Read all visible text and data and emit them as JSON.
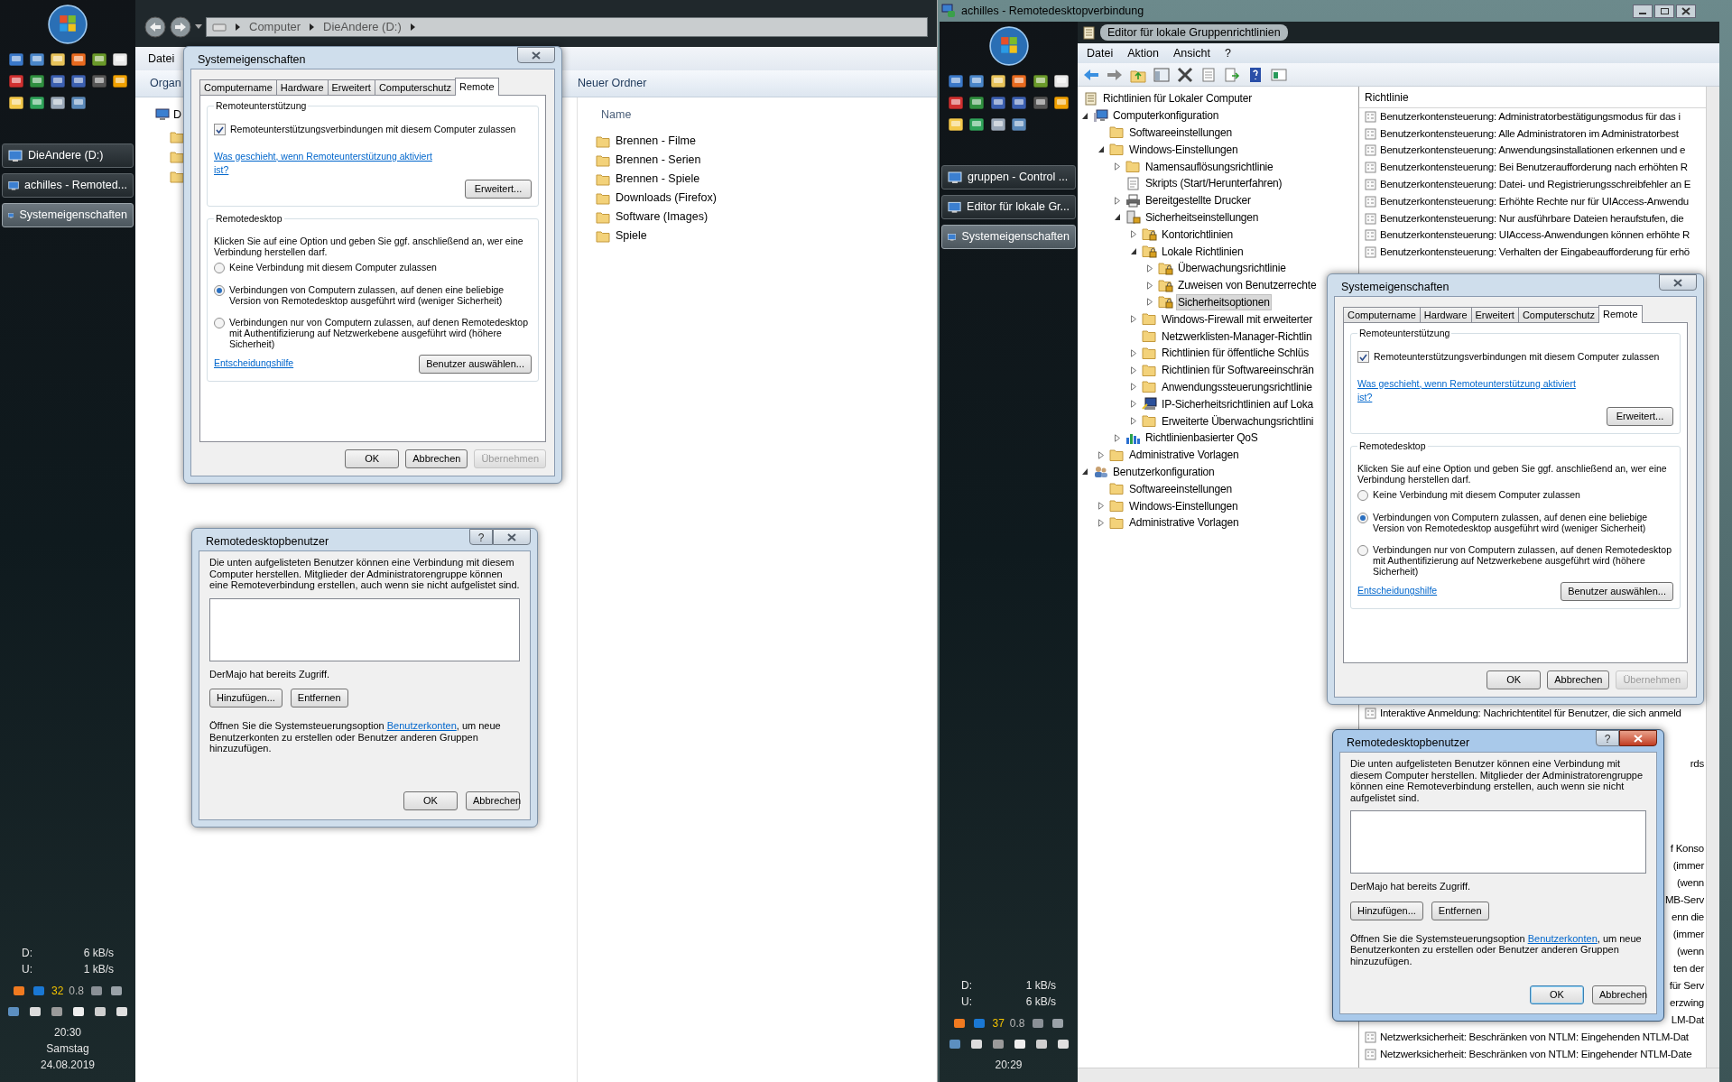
{
  "left_sidebar": {
    "taskbar": [
      {
        "label": "DieAndere (D:)",
        "selected": false
      },
      {
        "label": "achilles - Remoted...",
        "selected": false
      },
      {
        "label": "Systemeigenschaften",
        "selected": true
      }
    ],
    "net": [
      {
        "label": "D:",
        "value": "6 kB/s"
      },
      {
        "label": "U:",
        "value": "1 kB/s"
      }
    ],
    "tray_numbers": [
      {
        "text": "32",
        "color": "#f2c200"
      },
      {
        "text": "0.8",
        "color": "#b8b8b8"
      }
    ],
    "time": "20:30",
    "day": "Samstag",
    "date": "24.08.2019"
  },
  "explorer": {
    "breadcrumb": [
      "Computer",
      "DieAndere (D:)"
    ],
    "menu": [
      "Datei"
    ],
    "toolbar": [
      "Organ",
      "Neuer Ordner"
    ],
    "nav_label": "D",
    "column": "Name",
    "files": [
      "Brennen - Filme",
      "Brennen - Serien",
      "Brennen - Spiele",
      "Downloads (Firefox)",
      "Software (Images)",
      "Spiele"
    ]
  },
  "left_dialogs": {
    "system_properties": {
      "title": "Systemeigenschaften",
      "active": false,
      "tabs": [
        {
          "label": "Computername",
          "selected": false
        },
        {
          "label": "Hardware",
          "selected": false
        },
        {
          "label": "Erweitert",
          "selected": false
        },
        {
          "label": "Computerschutz",
          "selected": false
        },
        {
          "label": "Remote",
          "selected": true
        }
      ],
      "assistance": {
        "heading": "Remoteunterstützung",
        "checkbox": {
          "label": "Remoteunterstützungsverbindungen mit diesem Computer zulassen",
          "checked": true
        },
        "link": "Was geschieht, wenn Remoteunterstützung aktiviert ist?",
        "button": "Erweitert..."
      },
      "desktop": {
        "heading": "Remotedesktop",
        "intro": "Klicken Sie auf eine Option und geben Sie ggf. anschließend an, wer eine Verbindung herstellen darf.",
        "options": [
          {
            "label": "Keine Verbindung mit diesem Computer zulassen",
            "selected": false
          },
          {
            "label": "Verbindungen von Computern zulassen, auf denen eine beliebige Version von Remotedesktop ausgeführt wird (weniger Sicherheit)",
            "selected": true
          },
          {
            "label": "Verbindungen nur von Computern zulassen, auf denen Remotedesktop mit Authentifizierung auf Netzwerkebene ausgeführt wird (höhere Sicherheit)",
            "selected": false
          }
        ],
        "link": "Entscheidungshilfe",
        "button": "Benutzer auswählen..."
      },
      "buttons": [
        {
          "label": "OK",
          "disabled": false
        },
        {
          "label": "Abbrechen",
          "disabled": false
        },
        {
          "label": "Übernehmen",
          "disabled": true
        }
      ]
    },
    "remote_users": {
      "title": "Remotedesktopbenutzer",
      "active": false,
      "help": "?",
      "intro": "Die unten aufgelisteten Benutzer können eine Verbindung mit diesem Computer herstellen. Mitglieder der Administratorengruppe können eine Remoteverbindung erstellen, auch wenn sie nicht aufgelistet sind.",
      "status": "DerMajo hat bereits Zugriff.",
      "actions": [
        "Hinzufügen...",
        "Entfernen"
      ],
      "note_before": "Öffnen Sie die Systemsteuerungsoption ",
      "note_link": "Benutzerkonten",
      "note_after": ", um neue Benutzerkonten zu erstellen oder Benutzer anderen Gruppen hinzuzufügen.",
      "buttons": [
        "OK",
        "Abbrechen"
      ]
    }
  },
  "remote_window": {
    "title": "achilles - Remotedesktopverbindung",
    "sidebar": {
      "taskbar": [
        {
          "label": "gruppen - Control ...",
          "selected": false
        },
        {
          "label": "Editor für lokale Gr...",
          "selected": false
        },
        {
          "label": "Systemeigenschaften",
          "selected": true
        }
      ],
      "net": [
        {
          "label": "D:",
          "value": "1 kB/s"
        },
        {
          "label": "U:",
          "value": "6 kB/s"
        }
      ],
      "tray_numbers": [
        {
          "text": "37",
          "color": "#f2c200"
        },
        {
          "text": "0.8",
          "color": "#b8b8b8"
        }
      ],
      "time": "20:29"
    },
    "editor": {
      "title": "Editor für lokale Gruppenrichtlinien",
      "menu": [
        "Datei",
        "Aktion",
        "Ansicht",
        "?"
      ],
      "tree": [
        {
          "label": "Richtlinien für Lokaler Computer",
          "kind": "policy",
          "selected": false,
          "children": [
            {
              "label": "Computerkonfiguration",
              "kind": "computer",
              "expanded": true,
              "selected": false,
              "children": [
                {
                  "label": "Softwareeinstellungen",
                  "kind": "folder",
                  "selected": false
                },
                {
                  "label": "Windows-Einstellungen",
                  "kind": "folder",
                  "expanded": true,
                  "selected": false,
                  "children": [
                    {
                      "label": "Namensauflösungsrichtlinie",
                      "kind": "folder",
                      "expanded": false,
                      "selected": false
                    },
                    {
                      "label": "Skripts (Start/Herunterfahren)",
                      "kind": "script",
                      "selected": false
                    },
                    {
                      "label": "Bereitgestellte Drucker",
                      "kind": "printer",
                      "expanded": false,
                      "selected": false
                    },
                    {
                      "label": "Sicherheitseinstellungen",
                      "kind": "security",
                      "expanded": true,
                      "selected": false,
                      "children": [
                        {
                          "label": "Kontorichtlinien",
                          "kind": "secure-folder",
                          "expanded": false,
                          "selected": false
                        },
                        {
                          "label": "Lokale Richtlinien",
                          "kind": "secure-folder",
                          "expanded": true,
                          "selected": false,
                          "children": [
                            {
                              "label": "Überwachungsrichtlinie",
                              "kind": "secure-folder",
                              "expanded": false,
                              "selected": false
                            },
                            {
                              "label": "Zuweisen von Benutzerrechte",
                              "kind": "secure-folder",
                              "expanded": false,
                              "selected": false
                            },
                            {
                              "label": "Sicherheitsoptionen",
                              "kind": "secure-folder",
                              "expanded": false,
                              "selected": true
                            }
                          ]
                        },
                        {
                          "label": "Windows-Firewall mit erweiterter",
                          "kind": "folder",
                          "expanded": false,
                          "selected": false
                        },
                        {
                          "label": "Netzwerklisten-Manager-Richtlin",
                          "kind": "folder",
                          "selected": false
                        },
                        {
                          "label": "Richtlinien für öffentliche Schlüs",
                          "kind": "folder",
                          "expanded": false,
                          "selected": false
                        },
                        {
                          "label": "Richtlinien für Softwareeinschrän",
                          "kind": "folder",
                          "expanded": false,
                          "selected": false
                        },
                        {
                          "label": "Anwendungssteuerungsrichtlinie",
                          "kind": "folder",
                          "expanded": false,
                          "selected": false
                        },
                        {
                          "label": "IP-Sicherheitsrichtlinien auf Loka",
                          "kind": "network",
                          "expanded": false,
                          "selected": false
                        },
                        {
                          "label": "Erweiterte Überwachungsrichtlini",
                          "kind": "folder",
                          "expanded": false,
                          "selected": false
                        }
                      ]
                    },
                    {
                      "label": "Richtlinienbasierter QoS",
                      "kind": "chart",
                      "expanded": false,
                      "selected": false
                    }
                  ]
                },
                {
                  "label": "Administrative Vorlagen",
                  "kind": "folder",
                  "expanded": false,
                  "selected": false
                }
              ]
            },
            {
              "label": "Benutzerkonfiguration",
              "kind": "users",
              "expanded": true,
              "selected": false,
              "children": [
                {
                  "label": "Softwareeinstellungen",
                  "kind": "folder",
                  "selected": false
                },
                {
                  "label": "Windows-Einstellungen",
                  "kind": "folder",
                  "expanded": false,
                  "selected": false
                },
                {
                  "label": "Administrative Vorlagen",
                  "kind": "folder",
                  "expanded": false,
                  "selected": false
                }
              ]
            }
          ]
        }
      ],
      "list_header": "Richtlinie",
      "top_rows": [
        "Benutzerkontensteuerung: Administratorbestätigungsmodus für das i",
        "Benutzerkontensteuerung: Alle Administratoren im Administratorbest",
        "Benutzerkontensteuerung: Anwendungsinstallationen erkennen und e",
        "Benutzerkontensteuerung: Bei Benutzeraufforderung nach erhöhten R",
        "Benutzerkontensteuerung: Datei- und Registrierungsschreibfehler an E",
        "Benutzerkontensteuerung: Erhöhte Rechte nur für UIAccess-Anwendu",
        "Benutzerkontensteuerung: Nur ausführbare Dateien heraufstufen, die",
        "Benutzerkontensteuerung: UIAccess-Anwendungen können erhöhte R",
        "Benutzerkontensteuerung: Verhalten der Eingabeaufforderung für erhö"
      ],
      "middle_row": "Interaktive Anmeldung: Nachrichtentitel für Benutzer, die sich anmeld",
      "tail_rows": [
        "rds",
        "f Konso",
        "(immer",
        "(wenn",
        "MB-Serv",
        "enn die",
        "(immer",
        "(wenn",
        "ten der",
        "für Serv",
        "erzwing",
        "LM-Dat"
      ],
      "bottom_rows": [
        "Netzwerksicherheit: Beschränken von NTLM: Eingehenden NTLM-Dat",
        "Netzwerksicherheit: Beschränken von NTLM: Eingehender NTLM-Date"
      ]
    },
    "system_properties": {
      "title": "Systemeigenschaften",
      "active": false,
      "tabs": [
        {
          "label": "Computername",
          "selected": false
        },
        {
          "label": "Hardware",
          "selected": false
        },
        {
          "label": "Erweitert",
          "selected": false
        },
        {
          "label": "Computerschutz",
          "selected": false
        },
        {
          "label": "Remote",
          "selected": true
        }
      ],
      "assistance": {
        "heading": "Remoteunterstützung",
        "checkbox": {
          "label": "Remoteunterstützungsverbindungen mit diesem Computer zulassen",
          "checked": true
        },
        "link": "Was geschieht, wenn Remoteunterstützung aktiviert ist?",
        "button": "Erweitert..."
      },
      "desktop": {
        "heading": "Remotedesktop",
        "intro": "Klicken Sie auf eine Option und geben Sie ggf. anschließend an, wer eine Verbindung herstellen darf.",
        "options": [
          {
            "label": "Keine Verbindung mit diesem Computer zulassen",
            "selected": false
          },
          {
            "label": "Verbindungen von Computern zulassen, auf denen eine beliebige Version von Remotedesktop ausgeführt wird (weniger Sicherheit)",
            "selected": true
          },
          {
            "label": "Verbindungen nur von Computern zulassen, auf denen Remotedesktop mit Authentifizierung auf Netzwerkebene ausgeführt wird (höhere Sicherheit)",
            "selected": false
          }
        ],
        "link": "Entscheidungshilfe",
        "button": "Benutzer auswählen..."
      },
      "buttons": [
        {
          "label": "OK",
          "disabled": false
        },
        {
          "label": "Abbrechen",
          "disabled": false
        },
        {
          "label": "Übernehmen",
          "disabled": true
        }
      ]
    },
    "remote_users": {
      "title": "Remotedesktopbenutzer",
      "active": true,
      "help": "?",
      "intro": "Die unten aufgelisteten Benutzer können eine Verbindung mit diesem Computer herstellen. Mitglieder der Administratorengruppe können eine Remoteverbindung erstellen, auch wenn sie nicht aufgelistet sind.",
      "status": "DerMajo hat bereits Zugriff.",
      "actions": [
        "Hinzufügen...",
        "Entfernen"
      ],
      "note_before": "Öffnen Sie die Systemsteuerungsoption ",
      "note_link": "Benutzerkonten",
      "note_after": ", um neue Benutzerkonten zu erstellen oder Benutzer anderen Gruppen hinzuzufügen.",
      "buttons": [
        "OK",
        "Abbrechen"
      ]
    }
  }
}
